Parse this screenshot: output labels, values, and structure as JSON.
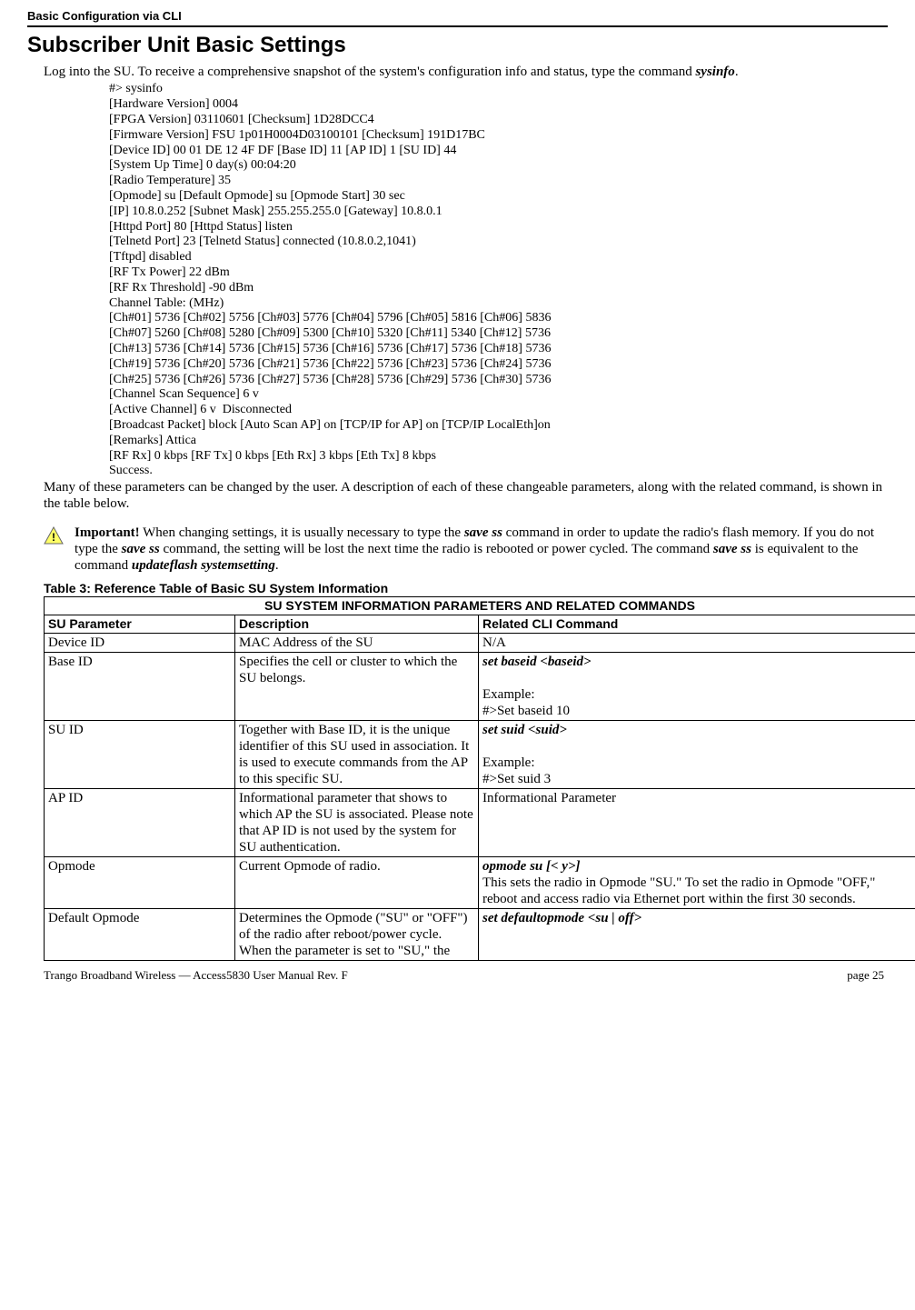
{
  "header": "Basic Configuration via CLI",
  "title": "Subscriber Unit Basic Settings",
  "intro_pre": "Log into the SU.  To receive a comprehensive snapshot of the system's configuration info and status, type the command ",
  "intro_cmd": "sysinfo",
  "intro_post": ".",
  "cli": "#> sysinfo\n[Hardware Version] 0004\n[FPGA Version] 03110601 [Checksum] 1D28DCC4\n[Firmware Version] FSU 1p01H0004D03100101 [Checksum] 191D17BC\n[Device ID] 00 01 DE 12 4F DF [Base ID] 11 [AP ID] 1 [SU ID] 44\n[System Up Time] 0 day(s) 00:04:20\n[Radio Temperature] 35\n[Opmode] su [Default Opmode] su [Opmode Start] 30 sec\n[IP] 10.8.0.252 [Subnet Mask] 255.255.255.0 [Gateway] 10.8.0.1\n[Httpd Port] 80 [Httpd Status] listen\n[Telnetd Port] 23 [Telnetd Status] connected (10.8.0.2,1041)\n[Tftpd] disabled\n[RF Tx Power] 22 dBm\n[RF Rx Threshold] -90 dBm\nChannel Table: (MHz)\n[Ch#01] 5736 [Ch#02] 5756 [Ch#03] 5776 [Ch#04] 5796 [Ch#05] 5816 [Ch#06] 5836\n[Ch#07] 5260 [Ch#08] 5280 [Ch#09] 5300 [Ch#10] 5320 [Ch#11] 5340 [Ch#12] 5736\n[Ch#13] 5736 [Ch#14] 5736 [Ch#15] 5736 [Ch#16] 5736 [Ch#17] 5736 [Ch#18] 5736\n[Ch#19] 5736 [Ch#20] 5736 [Ch#21] 5736 [Ch#22] 5736 [Ch#23] 5736 [Ch#24] 5736\n[Ch#25] 5736 [Ch#26] 5736 [Ch#27] 5736 [Ch#28] 5736 [Ch#29] 5736 [Ch#30] 5736\n[Channel Scan Sequence] 6 v\n[Active Channel] 6 v  Disconnected\n[Broadcast Packet] block [Auto Scan AP] on [TCP/IP for AP] on [TCP/IP LocalEth]on\n[Remarks] Attica\n[RF Rx] 0 kbps [RF Tx] 0 kbps [Eth Rx] 3 kbps [Eth Tx] 8 kbps\nSuccess.",
  "after_cli": "Many of these parameters can be changed by the user.  A description of each of these changeable parameters, along with the related command, is shown in the table below.",
  "note": {
    "important": "Important!",
    "l1": "  When changing settings, it is usually necessary to type the ",
    "save_ss": "save ss",
    "l2": " command in order to update the radio's flash memory.  If you do not type the ",
    "l3": " command, the setting will be lost the next time the radio is rebooted or power cycled.  The command ",
    "l4": " is equivalent to the command ",
    "uf": "updateflash systemsetting",
    "l5": "."
  },
  "table_title": "Table 3:  Reference Table of Basic SU System Information",
  "tbl": {
    "span_header": "SU  SYSTEM INFORMATION PARAMETERS AND RELATED COMMANDS",
    "h1": "SU Parameter",
    "h2": "Description",
    "h3": "Related CLI Command",
    "r1": {
      "p": "Device ID",
      "d": "MAC Address of the SU",
      "c": "N/A"
    },
    "r2": {
      "p": "Base ID",
      "d": "Specifies the cell or cluster to which the SU belongs.",
      "cmd": "set baseid <baseid>",
      "ex_label": "Example:",
      "ex": "#>Set baseid 10"
    },
    "r3": {
      "p": "SU ID",
      "d": "Together with Base ID, it is the unique identifier of this SU used in association.  It is used to execute commands from the AP to this specific SU.",
      "cmd": "set suid <suid>",
      "ex_label": "Example:",
      "ex": "#>Set suid 3"
    },
    "r4": {
      "p": "AP ID",
      "d": "Informational parameter that shows to which AP the SU is associated.  Please note that AP ID is not used by the system for SU authentication.",
      "c": "Informational Parameter"
    },
    "r5": {
      "p": "Opmode",
      "d": "Current Opmode of radio.",
      "cmd": "opmode su [< y>]",
      "rest": "This sets the radio in Opmode \"SU.\"  To set the radio in Opmode \"OFF,\" reboot and access radio via Ethernet port within the first 30 seconds."
    },
    "r6": {
      "p": "Default Opmode",
      "d": "Determines the Opmode (\"SU\" or \"OFF\") of the radio after reboot/power cycle.  When the parameter is set to \"SU,\" the",
      "cmd": "set defaultopmode <su | off>"
    }
  },
  "footer": {
    "left": "Trango Broadband Wireless — Access5830 User Manual  Rev. F",
    "right": "page 25"
  }
}
